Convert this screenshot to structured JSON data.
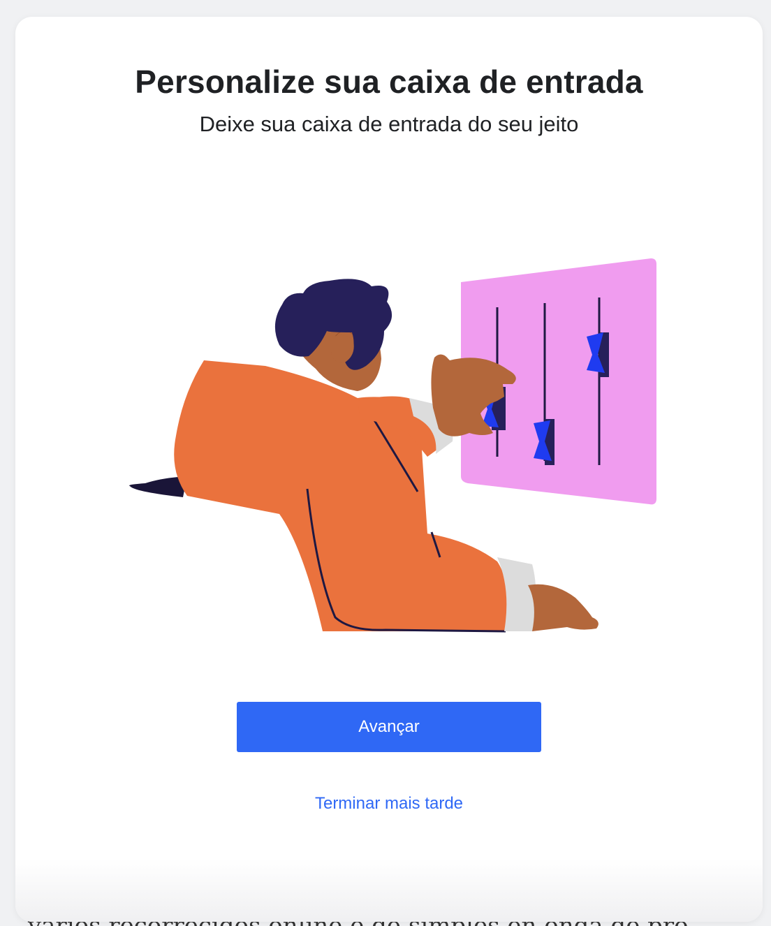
{
  "dialog": {
    "title": "Personalize sua caixa de entrada",
    "subtitle": "Deixe sua caixa de entrada do seu jeito",
    "primary_button_label": "Avançar",
    "secondary_link_label": "Terminar mais tarde"
  },
  "illustration": {
    "icon": "person-adjusting-sliders-illustration",
    "colors": {
      "panel": "#f09cef",
      "sleeve": "#ea723d",
      "skin": "#b3673b",
      "hair": "#26205a",
      "slider_knob": "#1f3bf0",
      "cuff": "#dcdcdc"
    }
  },
  "colors": {
    "accent": "#2f68f5",
    "title_text": "#1f2124",
    "background": "#f0f1f3"
  },
  "background_text": "varios recorrecidos online e de simples en onda de pro"
}
